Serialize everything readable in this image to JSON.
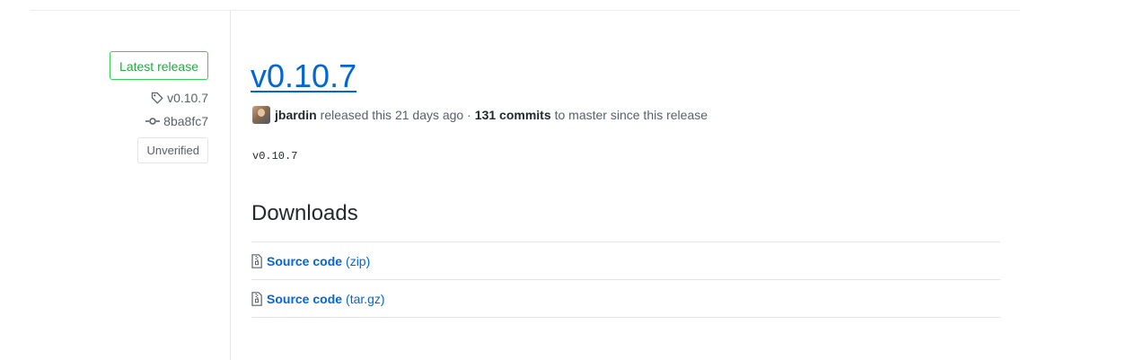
{
  "sidebar": {
    "latest_badge": "Latest release",
    "tag": "v0.10.7",
    "commit": "8ba8fc7",
    "verification": "Unverified",
    "icons": {
      "tag": "tag-icon",
      "commit": "git-commit-icon"
    }
  },
  "release": {
    "title": "v0.10.7",
    "author": "jbardin",
    "released_text": "released this 21 days ago ·",
    "commits_text": "131 commits",
    "since_text": "to master since this release",
    "body": "v0.10.7"
  },
  "downloads": {
    "heading": "Downloads",
    "items": [
      {
        "label": "Source code",
        "format": "(zip)",
        "icon": "file-zip-icon"
      },
      {
        "label": "Source code",
        "format": "(tar.gz)",
        "icon": "file-zip-icon"
      }
    ]
  },
  "colors": {
    "link": "#0366d6",
    "success": "#28a745",
    "muted": "#586069",
    "border": "#e1e4e8"
  }
}
